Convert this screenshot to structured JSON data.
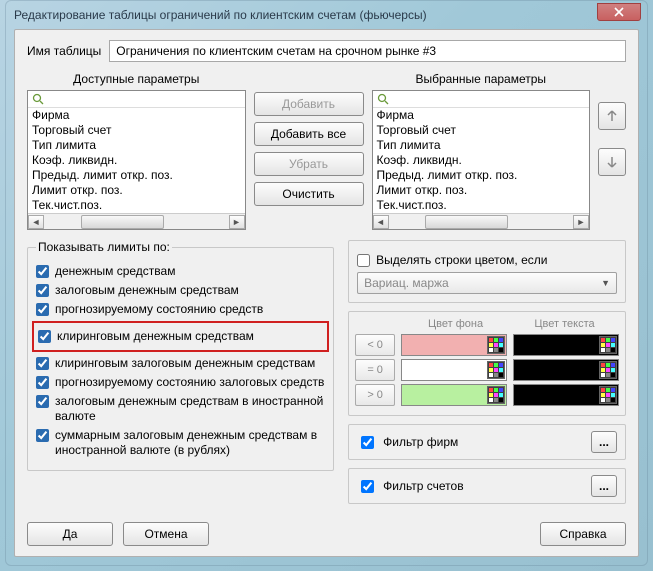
{
  "window": {
    "title": "Редактирование таблицы ограничений по клиентским счетам (фьючерсы)"
  },
  "table_name": {
    "label": "Имя таблицы",
    "value": "Ограничения по клиентским счетам на срочном рынке #3"
  },
  "params": {
    "available_header": "Доступные параметры",
    "selected_header": "Выбранные параметры",
    "available_items": [
      "Фирма",
      "Торговый счет",
      "Тип лимита",
      "Коэф. ликвидн.",
      "Предыд. лимит откр. поз.",
      "Лимит откр. поз.",
      "Тек.чист.поз."
    ],
    "selected_items": [
      "Фирма",
      "Торговый счет",
      "Тип лимита",
      "Коэф. ликвидн.",
      "Предыд. лимит откр. поз.",
      "Лимит откр. поз.",
      "Тек.чист.поз."
    ]
  },
  "buttons": {
    "add": "Добавить",
    "add_all": "Добавить все",
    "remove": "Убрать",
    "clear": "Очистить",
    "ok": "Да",
    "cancel": "Отмена",
    "help": "Справка",
    "dots": "..."
  },
  "limits": {
    "legend": "Показывать лимиты по:",
    "items": [
      {
        "label": "денежным средствам",
        "checked": true,
        "hl": false
      },
      {
        "label": "залоговым денежным средствам",
        "checked": true,
        "hl": false
      },
      {
        "label": "прогнозируемому состоянию средств",
        "checked": true,
        "hl": false
      },
      {
        "label": "клиринговым денежным средствам",
        "checked": true,
        "hl": true
      },
      {
        "label": "клиринговым залоговым денежным средствам",
        "checked": true,
        "hl": false
      },
      {
        "label": "прогнозируемому состоянию залоговых средств",
        "checked": true,
        "hl": false
      },
      {
        "label": "залоговым денежным средствам в иностранной валюте",
        "checked": true,
        "hl": false
      },
      {
        "label": "суммарным залоговым денежным средствам в иностранной валюте (в рублях)",
        "checked": true,
        "hl": false
      }
    ]
  },
  "highlight": {
    "checkbox_label": "Выделять строки цветом, если",
    "checked": false,
    "dropdown": "Вариац. маржа",
    "col_bg": "Цвет фона",
    "col_fg": "Цвет текста",
    "rows": [
      {
        "cmp": "< 0",
        "bg": "#f2b0b0",
        "fg": "#000000"
      },
      {
        "cmp": "= 0",
        "bg": "#ffffff",
        "fg": "#000000"
      },
      {
        "cmp": "> 0",
        "bg": "#b8f0a0",
        "fg": "#000000"
      }
    ]
  },
  "filters": {
    "firms": {
      "label": "Фильтр фирм",
      "checked": true
    },
    "accounts": {
      "label": "Фильтр счетов",
      "checked": true
    }
  }
}
